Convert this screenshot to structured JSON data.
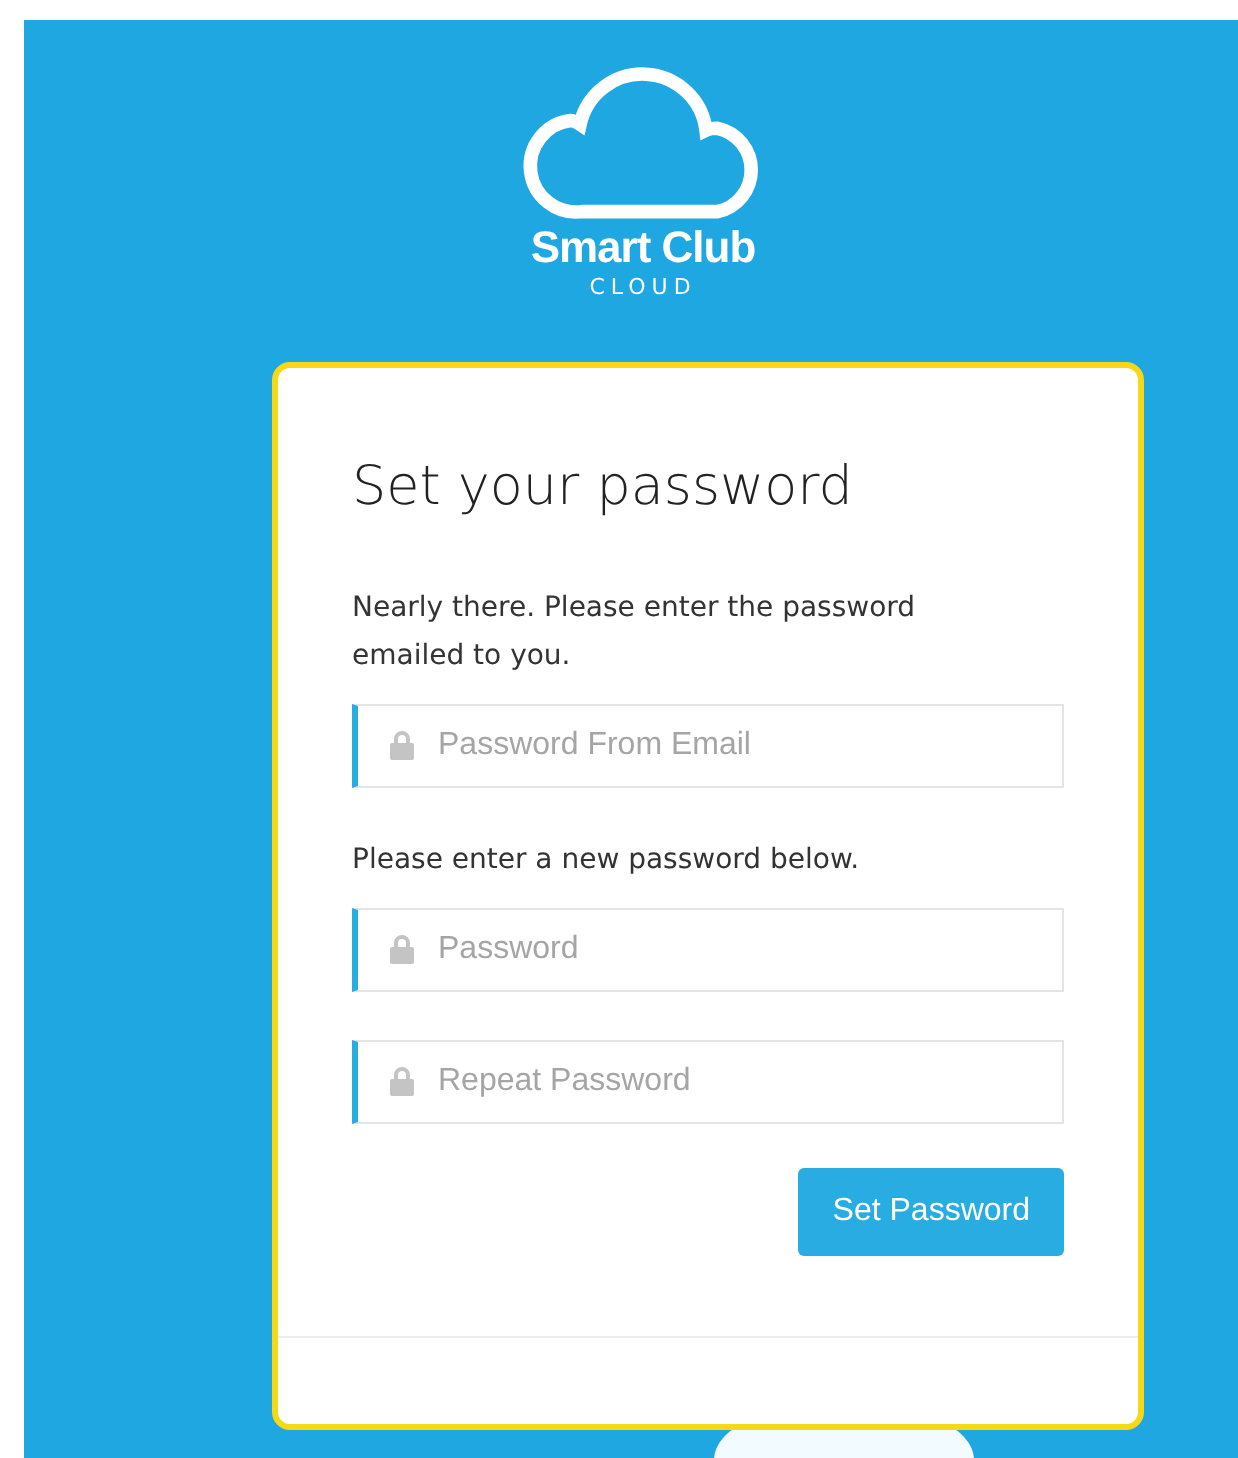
{
  "logo": {
    "name": "Smart Club",
    "tagline": "CLOUD"
  },
  "card": {
    "title": "Set your password",
    "sections": [
      {
        "text": "Nearly there. Please enter the password emailed to you.",
        "fields": [
          {
            "placeholder": "Password From Email"
          }
        ]
      },
      {
        "text": "Please enter a new password below.",
        "fields": [
          {
            "placeholder": "Password"
          },
          {
            "placeholder": "Repeat Password"
          }
        ]
      }
    ],
    "button": "Set Password"
  }
}
